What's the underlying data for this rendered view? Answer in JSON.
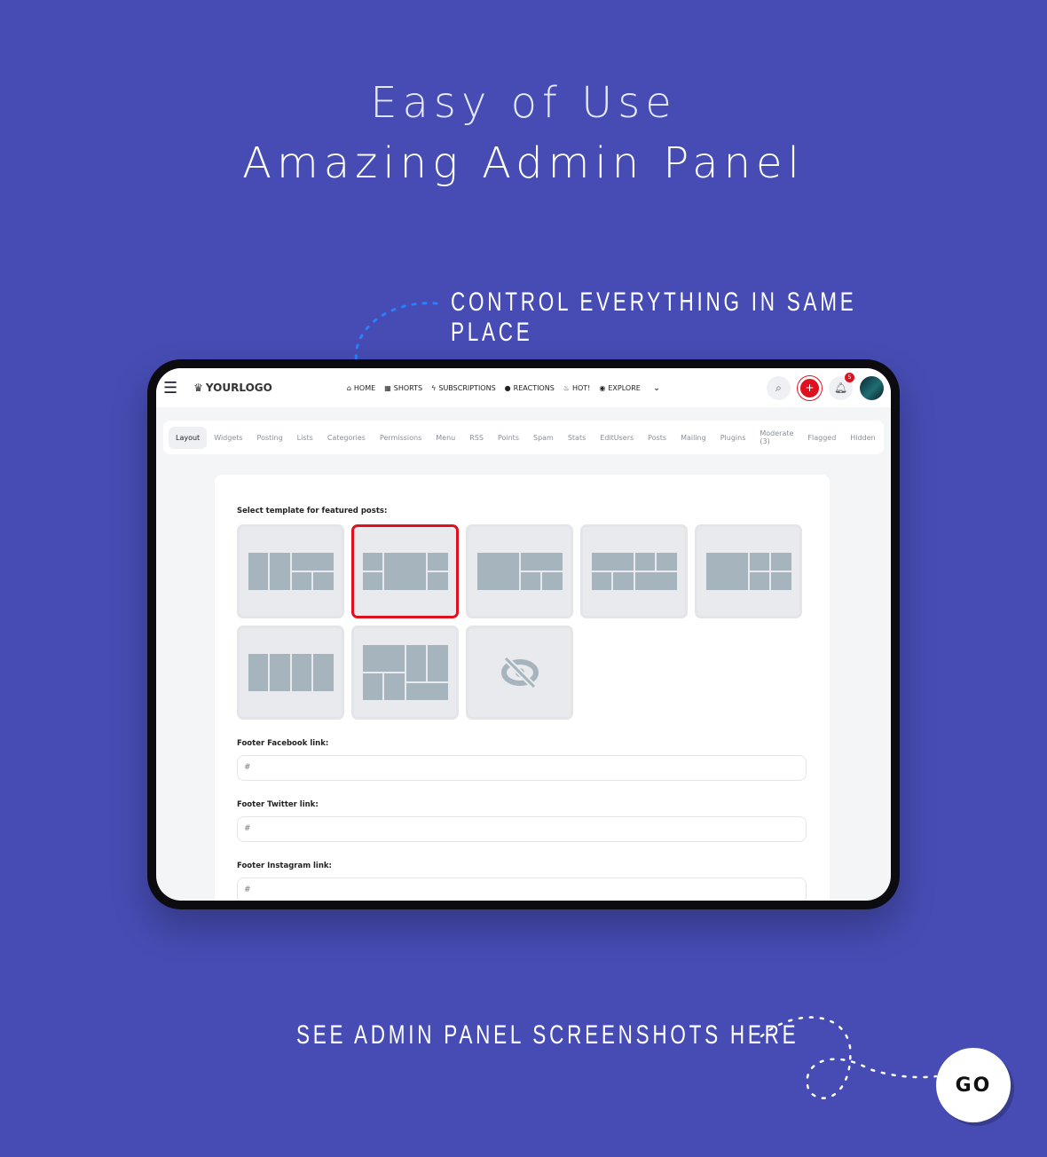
{
  "headline": {
    "line1": "Easy of Use",
    "line2": "Amazing Admin Panel"
  },
  "callout_top": "CONTROL EVERYTHING IN SAME PLACE",
  "callout_bottom": "SEE ADMIN PANEL SCREENSHOTS HERE",
  "go_button": "GO",
  "colors": {
    "background": "#464cb3",
    "accent": "#e0101f",
    "dashed_line_top": "#2a7fff"
  },
  "app": {
    "logo": "YOURLOGO",
    "nav": [
      {
        "icon": "home-icon",
        "label": "HOME"
      },
      {
        "icon": "film-icon",
        "label": "SHORTS"
      },
      {
        "icon": "bolt-icon",
        "label": "SUBSCRIPTIONS"
      },
      {
        "icon": "smile-icon",
        "label": "REACTIONS"
      },
      {
        "icon": "fire-icon",
        "label": "HOT!"
      },
      {
        "icon": "compass-icon",
        "label": "EXPLORE"
      }
    ],
    "notification_count": "5",
    "tabs": [
      "Layout",
      "Widgets",
      "Posting",
      "Lists",
      "Categories",
      "Permissions",
      "Menu",
      "RSS",
      "Points",
      "Spam",
      "Stats",
      "EditUsers",
      "Posts",
      "Mailing",
      "Plugins",
      "Moderate (3)",
      "Flagged",
      "Hidden"
    ],
    "active_tab": "Layout",
    "template_label": "Select template for featured posts:",
    "selected_template": 2,
    "template_count": 8,
    "fields": [
      {
        "label": "Footer Facebook link:",
        "value": "#"
      },
      {
        "label": "Footer Twitter link:",
        "value": "#"
      },
      {
        "label": "Footer Instagram link:",
        "value": "#"
      }
    ]
  }
}
